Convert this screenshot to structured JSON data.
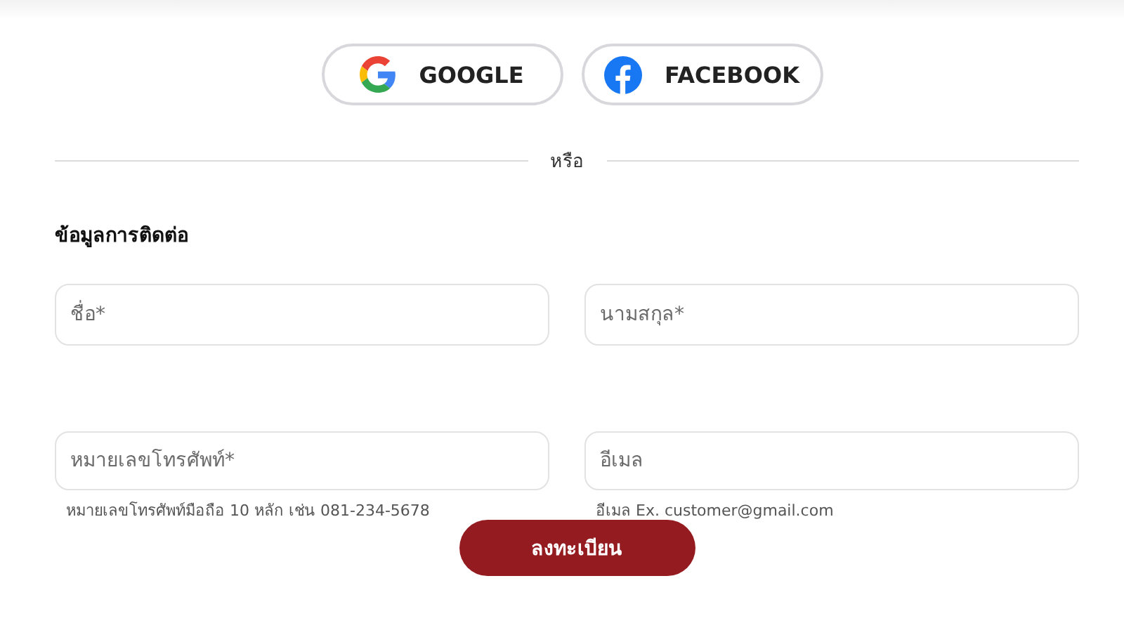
{
  "social_buttons": [
    {
      "kind": "google",
      "label": "GOOGLE"
    },
    {
      "kind": "facebook",
      "label": "FACEBOOK"
    }
  ],
  "divider_text": "หรือ",
  "section_title": "ข้อมูลการติดต่อ",
  "fields": [
    {
      "placeholder": "ชื่อ*"
    },
    {
      "placeholder": "นามสกุล*"
    },
    {
      "placeholder": "หมายเลขโทรศัพท์*",
      "hint": "หมายเลขโทรศัพท์มือถือ 10 หลัก เช่น 081-234-5678"
    },
    {
      "placeholder": "อีเมล",
      "hint": "อีเมล Ex. customer@gmail.com"
    }
  ],
  "submit": "ลงทะเบียน"
}
